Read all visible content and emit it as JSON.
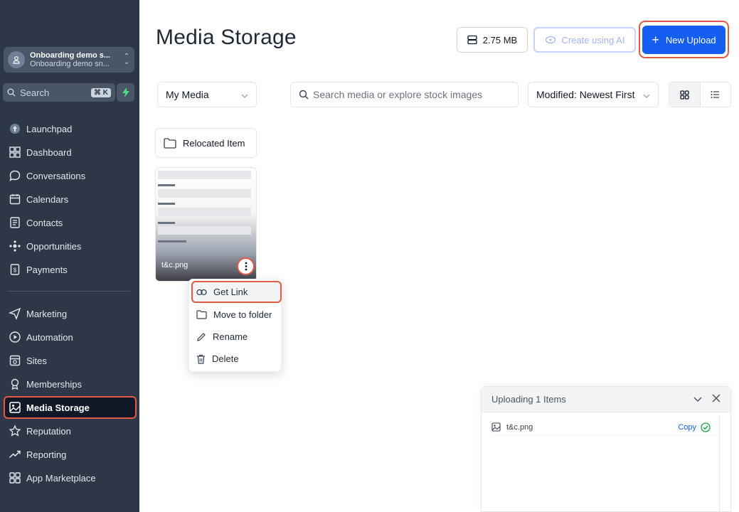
{
  "sidebar": {
    "account": {
      "name": "Onboarding demo s...",
      "sub": "Onboarding demo sn..."
    },
    "search": {
      "placeholder": "Search",
      "shortcut": "⌘ K"
    },
    "items": [
      {
        "label": "Launchpad",
        "icon": "launchpad-icon"
      },
      {
        "label": "Dashboard",
        "icon": "dashboard-icon"
      },
      {
        "label": "Conversations",
        "icon": "chat-icon"
      },
      {
        "label": "Calendars",
        "icon": "calendar-icon"
      },
      {
        "label": "Contacts",
        "icon": "contacts-icon"
      },
      {
        "label": "Opportunities",
        "icon": "opportunities-icon"
      },
      {
        "label": "Payments",
        "icon": "payments-icon"
      },
      {
        "label": "Marketing",
        "icon": "send-icon"
      },
      {
        "label": "Automation",
        "icon": "play-icon"
      },
      {
        "label": "Sites",
        "icon": "sites-icon"
      },
      {
        "label": "Memberships",
        "icon": "award-icon"
      },
      {
        "label": "Media Storage",
        "icon": "image-icon",
        "active": true
      },
      {
        "label": "Reputation",
        "icon": "star-icon"
      },
      {
        "label": "Reporting",
        "icon": "trend-icon"
      },
      {
        "label": "App Marketplace",
        "icon": "apps-icon"
      }
    ]
  },
  "header": {
    "title": "Media Storage",
    "storage_label": "2.75 MB",
    "ai_label": "Create using AI",
    "upload_label": "New Upload"
  },
  "filters": {
    "scope": "My Media",
    "search_placeholder": "Search media or explore stock images",
    "sort": "Modified: Newest First"
  },
  "folder": {
    "name": "Relocated Item"
  },
  "file": {
    "name": "t&c.png",
    "preview": {
      "fields": [
        "First Name",
        "Last Name",
        "Email",
        "Phone"
      ],
      "labels": [
        "Last Name",
        "Email *",
        "Phone *",
        "Consent Checkbox"
      ]
    }
  },
  "context_menu": {
    "items": [
      {
        "label": "Get Link",
        "icon": "link-icon"
      },
      {
        "label": "Move to folder",
        "icon": "folder-icon"
      },
      {
        "label": "Rename",
        "icon": "pencil-icon"
      },
      {
        "label": "Delete",
        "icon": "trash-icon"
      }
    ]
  },
  "upload_panel": {
    "title": "Uploading 1 Items",
    "file_name": "t&c.png",
    "copy_label": "Copy"
  },
  "colors": {
    "sidebar_bg": "#2d3748",
    "accent": "#155eef",
    "highlight": "#e05a45",
    "success": "#16a34a"
  }
}
